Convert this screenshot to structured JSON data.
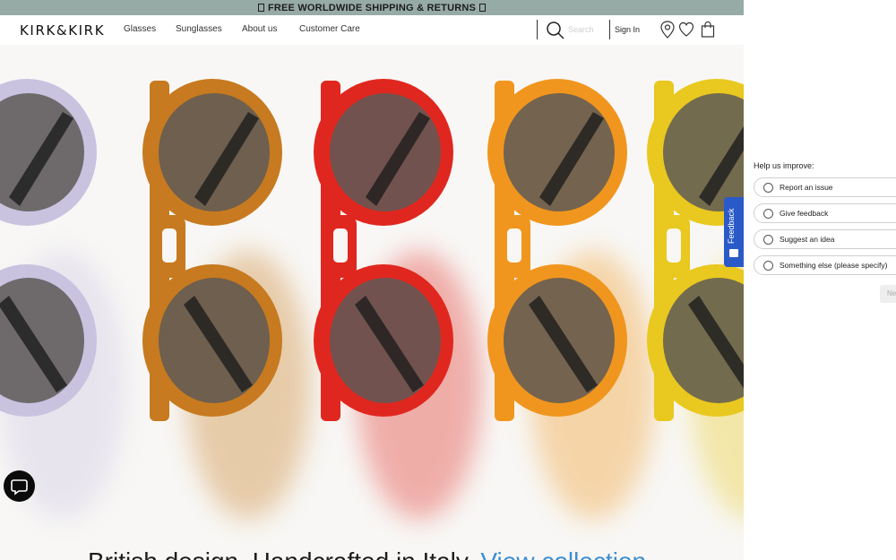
{
  "promo": {
    "text": "FREE WORLDWIDE SHIPPING & RETURNS"
  },
  "nav": {
    "logo": "KIRK&KIRK",
    "links": [
      "Glasses",
      "Sunglasses",
      "About us",
      "Customer Care"
    ],
    "search_placeholder": "Search",
    "signin": "Sign In",
    "icons": [
      "search-icon",
      "location-pin-icon",
      "heart-icon",
      "shopping-bag-icon"
    ]
  },
  "hero": {
    "tagline": "British design. Handcrafted in Italy.",
    "cta": "View collection",
    "frame_colors": [
      "#c9c3e0",
      "#c77a1f",
      "#e0271f",
      "#f0961e",
      "#e9c81f"
    ],
    "lens_color": "#5e5a57",
    "cta_color": "#3d8fd0"
  },
  "feedback": {
    "tab_label": "Feedback",
    "title": "Help us improve:",
    "options": [
      "Report an issue",
      "Give feedback",
      "Suggest an idea",
      "Something else (please specify)"
    ],
    "next": "Ne",
    "tab_color": "#2a5ac7"
  }
}
